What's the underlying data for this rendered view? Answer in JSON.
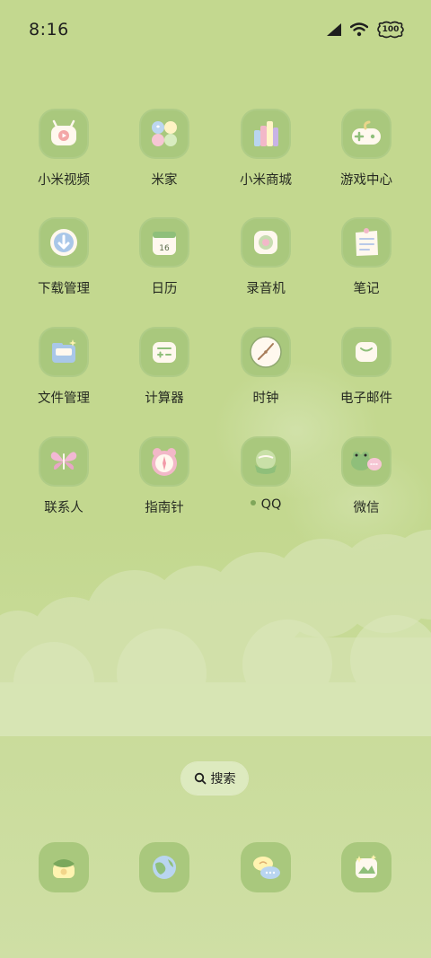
{
  "status_bar": {
    "time": "8:16",
    "battery": "100",
    "icons": [
      "signal-icon",
      "wifi-icon",
      "battery-icon"
    ]
  },
  "apps": [
    {
      "label": "小米视频",
      "icon": "tv-icon"
    },
    {
      "label": "米家",
      "icon": "mijia-grid-icon"
    },
    {
      "label": "小米商城",
      "icon": "shopping-bars-icon"
    },
    {
      "label": "游戏中心",
      "icon": "gamepad-icon"
    },
    {
      "label": "下载管理",
      "icon": "download-icon"
    },
    {
      "label": "日历",
      "icon": "calendar-icon",
      "calendar_day": "16"
    },
    {
      "label": "录音机",
      "icon": "recorder-icon"
    },
    {
      "label": "笔记",
      "icon": "notes-icon"
    },
    {
      "label": "文件管理",
      "icon": "folder-icon"
    },
    {
      "label": "计算器",
      "icon": "calculator-icon"
    },
    {
      "label": "时钟",
      "icon": "clock-icon"
    },
    {
      "label": "电子邮件",
      "icon": "mail-icon"
    },
    {
      "label": "联系人",
      "icon": "butterfly-icon"
    },
    {
      "label": "指南针",
      "icon": "compass-icon"
    },
    {
      "label": "QQ",
      "icon": "qq-penguin-icon",
      "has_update_dot": true
    },
    {
      "label": "微信",
      "icon": "wechat-frog-icon"
    }
  ],
  "search": {
    "label": "搜索",
    "icon": "search-icon"
  },
  "dock": [
    {
      "icon": "phone-icon"
    },
    {
      "icon": "browser-globe-icon"
    },
    {
      "icon": "messages-icon"
    },
    {
      "icon": "gallery-icon"
    }
  ],
  "colors": {
    "background": "#c2d78f",
    "icon_tile": "#a9c87d",
    "text": "#262a22"
  }
}
